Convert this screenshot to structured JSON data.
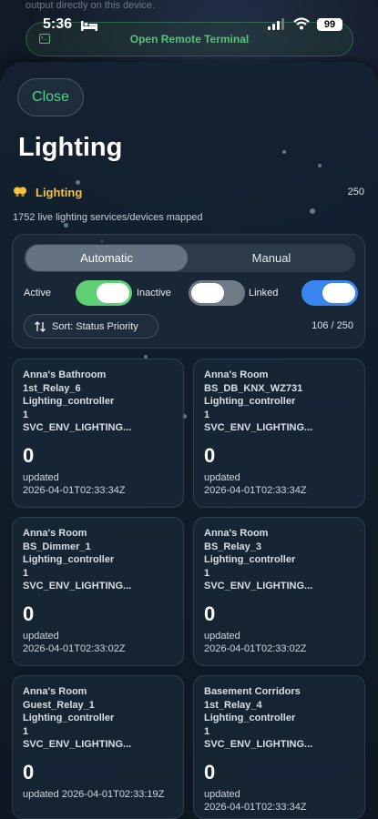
{
  "background_app": {
    "hint_text": "output directly on this device.",
    "remote_button_label": "Open Remote Terminal"
  },
  "status_bar": {
    "time": "5:36",
    "battery": "99"
  },
  "sheet": {
    "close_label": "Close",
    "title": "Lighting",
    "section": {
      "label": "Lighting",
      "count": "250",
      "subtitle": "1752 live lighting services/devices mapped"
    },
    "controls": {
      "tabs": [
        "Automatic",
        "Manual"
      ],
      "active_tab": "Automatic",
      "toggles": [
        {
          "label": "Active",
          "state": "on",
          "color": "#5fcf73"
        },
        {
          "label": "Inactive",
          "state": "off",
          "color": "#6f7a86"
        },
        {
          "label": "Linked",
          "state": "on",
          "color": "#3a86f0"
        }
      ],
      "sort_label": "Sort: Status Priority",
      "page_count": "106 / 250"
    },
    "cards": [
      {
        "lines": [
          "Anna's Bathroom",
          "1st_Relay_6",
          "Lighting_controller",
          "1",
          "SVC_ENV_LIGHTING..."
        ],
        "value": "0",
        "updated_label": "updated",
        "timestamp": "2026-04-01T02:33:34Z"
      },
      {
        "lines": [
          "Anna's Room",
          "BS_DB_KNX_WZ731",
          "Lighting_controller",
          "1",
          "SVC_ENV_LIGHTING..."
        ],
        "value": "0",
        "updated_label": "updated",
        "timestamp": "2026-04-01T02:33:34Z"
      },
      {
        "lines": [
          "Anna's Room",
          "BS_Dimmer_1",
          "Lighting_controller",
          "1",
          "SVC_ENV_LIGHTING..."
        ],
        "value": "0",
        "updated_label": "updated",
        "timestamp": "2026-04-01T02:33:02Z"
      },
      {
        "lines": [
          "Anna's Room",
          "BS_Relay_3",
          "Lighting_controller",
          "1",
          "SVC_ENV_LIGHTING..."
        ],
        "value": "0",
        "updated_label": "updated",
        "timestamp": "2026-04-01T02:33:02Z"
      },
      {
        "lines": [
          "Anna's Room",
          "Guest_Relay_1",
          "Lighting_controller",
          "1",
          "SVC_ENV_LIGHTING..."
        ],
        "value": "0",
        "updated_label": "updated",
        "timestamp": "2026-04-01T02:33:19Z"
      },
      {
        "lines": [
          "Basement Corridors",
          "1st_Relay_4",
          "Lighting_controller",
          "1",
          "SVC_ENV_LIGHTING..."
        ],
        "value": "0",
        "updated_label": "updated",
        "timestamp": "2026-04-01T02:33:34Z"
      }
    ]
  },
  "colors": {
    "accent_green": "#4fd28a",
    "section_yellow": "#f2c23a",
    "linked_blue": "#3a86f0"
  }
}
